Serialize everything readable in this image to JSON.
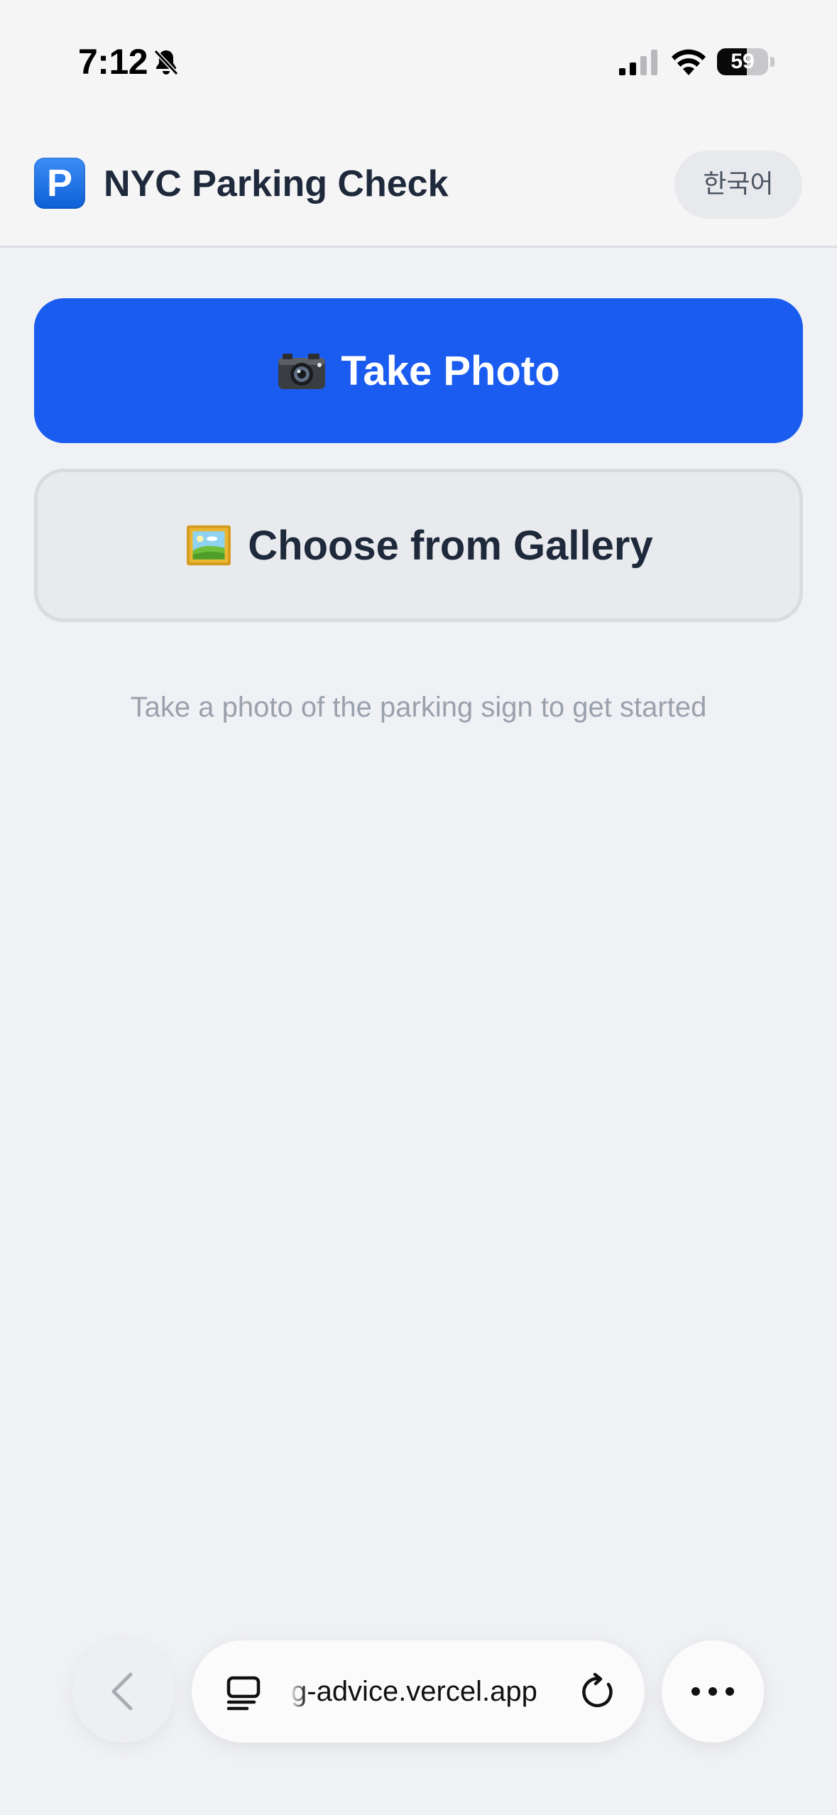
{
  "status_bar": {
    "time": "7:12",
    "battery_level": "59",
    "battery_fraction": 0.59,
    "icons": [
      "bell-slash-icon",
      "cellular-signal-icon",
      "wifi-icon",
      "battery-icon"
    ]
  },
  "header": {
    "app_icon": "parking-sign-icon",
    "app_icon_letter": "P",
    "title": "NYC Parking Check",
    "language_button": "한국어"
  },
  "actions": {
    "take_photo": {
      "icon": "camera-icon",
      "label": "Take Photo"
    },
    "choose_gallery": {
      "icon": "framed-picture-icon",
      "label": "Choose from Gallery"
    }
  },
  "hint": "Take a photo of the parking sign to get started",
  "browser": {
    "url": "g-advice.vercel.app",
    "icons": [
      "chevron-left-icon",
      "tabs-icon",
      "reload-icon",
      "more-icon"
    ]
  },
  "colors": {
    "primary": "#1b5cf0",
    "background": "#f0f1f4",
    "title_text": "#1e293b",
    "hint_text": "#9aa1ad"
  }
}
